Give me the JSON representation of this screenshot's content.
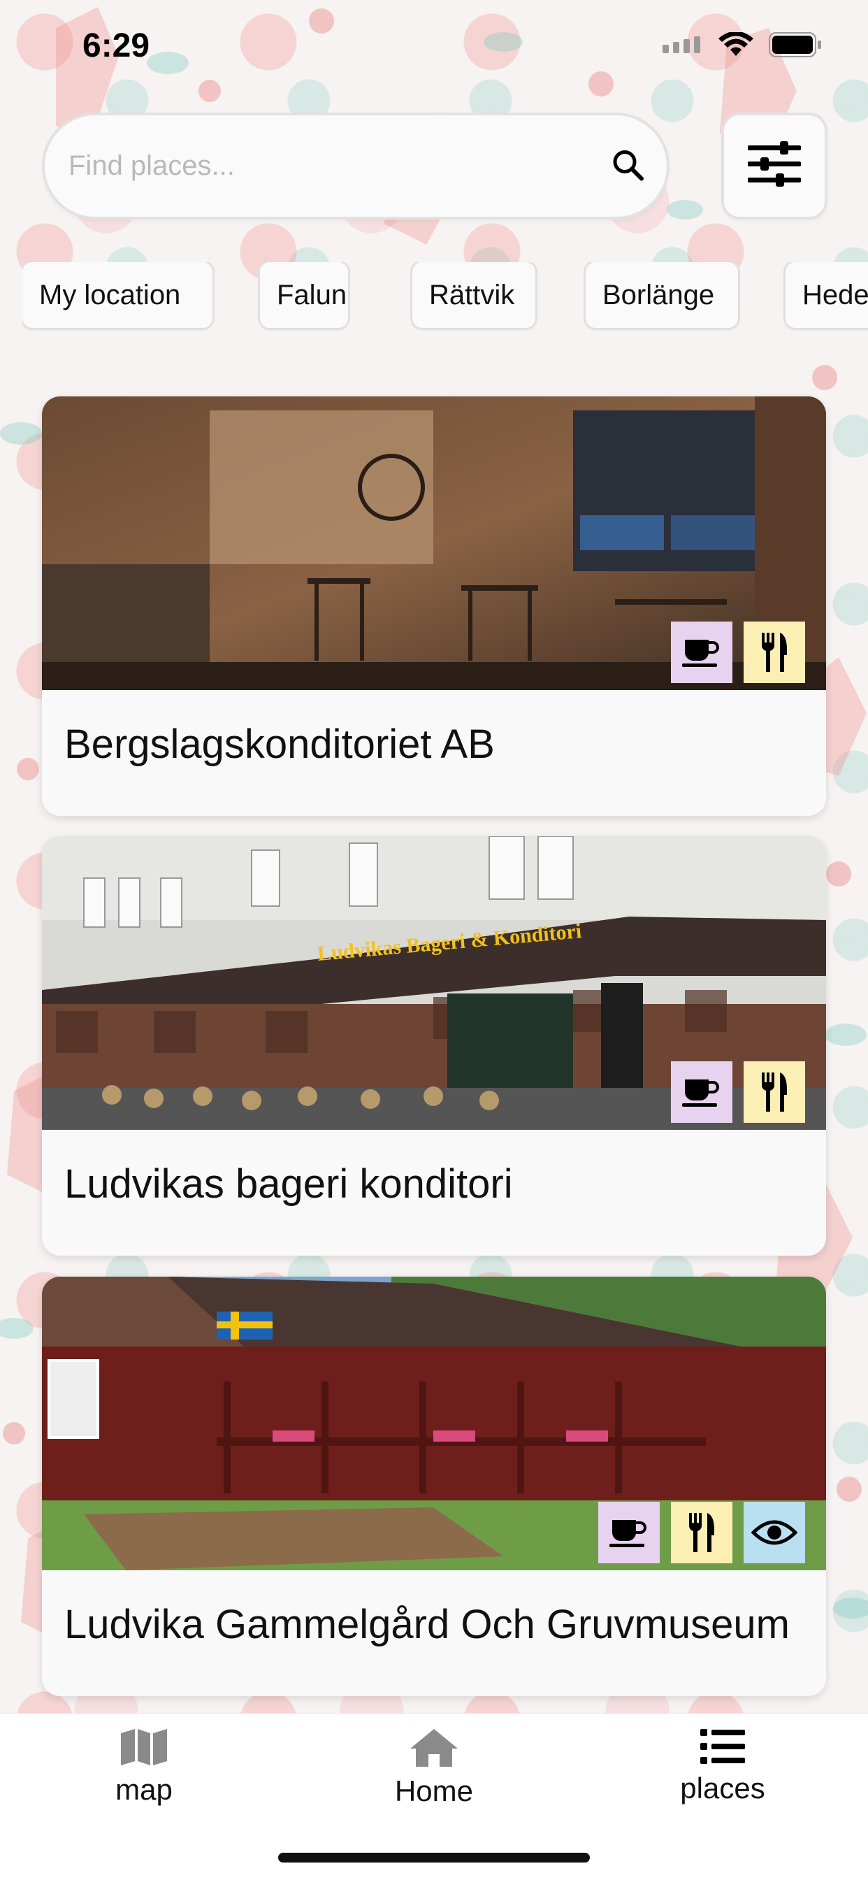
{
  "status_bar": {
    "time": "6:29"
  },
  "search": {
    "placeholder": "Find places..."
  },
  "chips": [
    "My location",
    "Falun",
    "Rättvik",
    "Borlänge",
    "Hedemora"
  ],
  "cards": [
    {
      "title": "Bergslagskonditoriet AB",
      "badges": [
        "cafe-icon",
        "restaurant-icon"
      ]
    },
    {
      "title": "Ludvikas bageri konditori",
      "badges": [
        "cafe-icon",
        "restaurant-icon"
      ]
    },
    {
      "title": "Ludvika Gammelgård Och Gruvmuseum",
      "badges": [
        "cafe-icon",
        "restaurant-icon",
        "sightseeing-icon"
      ]
    }
  ],
  "photo_text": {
    "storefront_sign": "Ludvikas Bageri & Konditori"
  },
  "tabbar": {
    "map": "map",
    "home": "Home",
    "places": "places"
  },
  "colors": {
    "cafe_badge": "#e7d3ef",
    "restaurant_badge": "#fbefb4",
    "sightseeing_badge": "#b9dff0"
  }
}
